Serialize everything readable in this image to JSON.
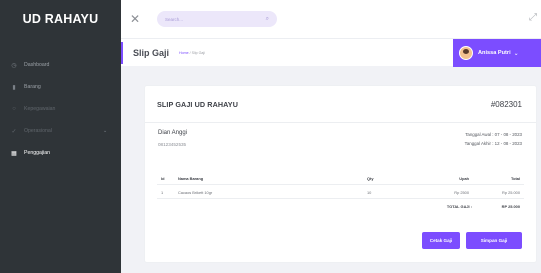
{
  "sidebar": {
    "brand": "UD RAHAYU",
    "items": [
      {
        "label": "Dashboard",
        "icon": "dashboard-icon"
      },
      {
        "label": "Barang",
        "icon": "box-icon"
      },
      {
        "label": "Kepegawaian",
        "icon": "people-icon"
      },
      {
        "label": "Operasional",
        "icon": "tools-icon"
      },
      {
        "label": "Penggajian",
        "icon": "receipt-icon"
      }
    ]
  },
  "topbar": {
    "close_glyph": "✕",
    "search_placeholder": "Search...",
    "fullscreen_glyph": "⤢"
  },
  "titlebar": {
    "title": "Slip Gaji",
    "crumb_home": "Home",
    "crumb_sep": " / ",
    "crumb_current": "Slip Gaji",
    "user_name": "Anissa Putri"
  },
  "slip": {
    "title": "SLIP GAJI UD RAHAYU",
    "number": "#082301",
    "employee_name": "Dian Anggi",
    "employee_phone": "08123452535",
    "date_start": "Tanggal Awal : 07 - 08 - 2023",
    "date_end": "Tanggal Akhir : 12 - 08 - 2023",
    "columns": {
      "id": "Id",
      "name": "Nama Barang",
      "qty": "Qty",
      "upah": "Upah",
      "total": "Total"
    },
    "rows": [
      {
        "id": "1",
        "name": "Cacaos Brikett 10gr",
        "qty": "10",
        "upah": "Rp 2500",
        "total": "Rp 25.000"
      }
    ],
    "total_label": "TOTAL GAJI :",
    "total_value": "RP 25.000",
    "print_button": "Cetak Gaji",
    "save_button": "Simpan Gaji"
  },
  "colors": {
    "accent": "#7c4dff",
    "sidebar": "#2f3438",
    "background": "#f1f2f6"
  }
}
